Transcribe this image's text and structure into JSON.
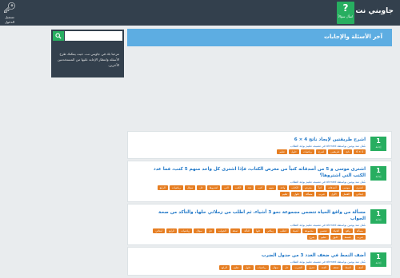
{
  "header": {
    "site_name": "جاوبني نت",
    "ask_label": "اسأل سؤالاً",
    "ask_icon": "?",
    "login_label": "تسجيل الدخول"
  },
  "sidebar": {
    "search_placeholder": "",
    "welcome_text": "مرحبا بك في جاوبني نت، حيث يمكنك طرح الأسئلة وانتظار الإجابة عليها من المستخدمين الآخرين."
  },
  "main": {
    "heading": "آخر الأسئلة والإجابات"
  },
  "questions": [
    {
      "votes": "1",
      "votes_label": "إجابة",
      "title": "اشرح طريقتين لإيجاد ناتج 4 × 6",
      "meta": "سُئل منذ يومين بواسطة ahmed في تصنيف تعليم بوابة الطلاب",
      "tags": [
        "4 × 6",
        "ناتج",
        "طريقتين",
        "اشرح",
        "رياضيات",
        "حلول",
        "تعليم"
      ]
    },
    {
      "votes": "1",
      "votes_label": "إجابة",
      "title": "اشترى موسى و 5 من أصدقائه كتباً من معرض الكتاب، فإذا اشترى كل واحد منهم 5 كتب، فما عدد الكتب التي اشتروها؟",
      "meta": "سُئل منذ يومين بواسطة ahmed في تصنيف تعليم بوابة الطلاب",
      "tags": [
        "اشترى",
        "موسى",
        "أصدقائه",
        "كتباً",
        "معرض",
        "الكتاب",
        "واحد",
        "منهم",
        "كتب",
        "عدد",
        "الكتب",
        "التي",
        "اشتروها",
        "حل",
        "سؤال",
        "رياضيات",
        "الرابع",
        "ابتدائي",
        "الفصل",
        "الأول",
        "ضرب",
        "مسألة",
        "حلول",
        "تعليم"
      ]
    },
    {
      "votes": "1",
      "votes_label": "إجابة",
      "title": "مسألة من واقع الحياة تتضمن مجموعة نحو 3 أشياء، ثم اطلب من زملائي حلها، والتأكد من صحة الجواب",
      "meta": "سُئل منذ يومين بواسطة ahmed في تصنيف تعليم بوابة الطلاب",
      "tags": [
        "مسألة",
        "واقع",
        "الحياة",
        "تتضمن",
        "مجموعة",
        "أشياء",
        "اطلب",
        "زملائي",
        "حلها",
        "التأكد",
        "صحة",
        "الجواب",
        "حل",
        "سؤال",
        "رياضيات",
        "الرابع",
        "ابتدائي",
        "ضرب",
        "قسمة",
        "حلول",
        "تعليم",
        "شرح"
      ]
    },
    {
      "votes": "1",
      "votes_label": "إجابة",
      "title": "أضف النمط في ضعف العدد 3 من جدول الضرب",
      "meta": "سُئل منذ يومين بواسطة ahmed في تصنيف تعليم بوابة الطلاب",
      "tags": [
        "أضف",
        "النمط",
        "ضعف",
        "العدد",
        "جدول",
        "الضرب",
        "حل",
        "سؤال",
        "رياضيات",
        "حلول",
        "تعليم",
        "الرابع"
      ]
    }
  ],
  "colors": {
    "topbar": "#33404d",
    "accent": "#27ae60",
    "heading": "#5dade2",
    "tag": "#e67e22",
    "link": "#1f77c7"
  },
  "icons": {
    "ask": "question-icon",
    "login": "key-icon",
    "search": "search-icon"
  }
}
